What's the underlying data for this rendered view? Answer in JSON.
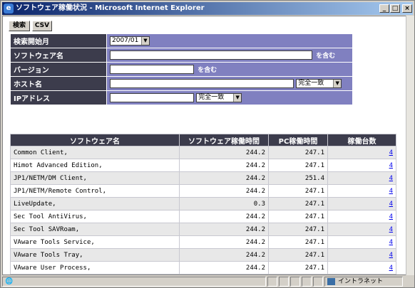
{
  "window": {
    "title": "ソフトウェア稼働状況 - Microsoft Internet Explorer",
    "min": "_",
    "max": "□",
    "close": "×"
  },
  "toolbar": {
    "search_label": "検索",
    "csv_label": "CSV"
  },
  "form": {
    "rows": [
      {
        "label": "検索開始月",
        "value": "2007/01"
      },
      {
        "label": "ソフトウェア名",
        "value": "",
        "suffix": "を含む"
      },
      {
        "label": "バージョン",
        "value": "",
        "suffix": "を含む"
      },
      {
        "label": "ホスト名",
        "value": "",
        "match": "完全一致"
      },
      {
        "label": "IPアドレス",
        "value": "",
        "match": "完全一致"
      }
    ]
  },
  "table": {
    "headers": [
      "ソフトウェア名",
      "ソフトウェア稼働時間",
      "PC稼働時間",
      "稼働台数"
    ],
    "rows": [
      {
        "name": "Common Client,",
        "sw_hours": "244.2",
        "pc_hours": "247.1",
        "count": "4"
      },
      {
        "name": "Himot Advanced Edition,",
        "sw_hours": "244.2",
        "pc_hours": "247.1",
        "count": "4"
      },
      {
        "name": "JP1/NETM/DM Client,",
        "sw_hours": "244.2",
        "pc_hours": "251.4",
        "count": "4"
      },
      {
        "name": "JP1/NETM/Remote Control,",
        "sw_hours": "244.2",
        "pc_hours": "247.1",
        "count": "4"
      },
      {
        "name": "LiveUpdate,",
        "sw_hours": "0.3",
        "pc_hours": "247.1",
        "count": "4"
      },
      {
        "name": "Sec Tool AntiVirus,",
        "sw_hours": "244.2",
        "pc_hours": "247.1",
        "count": "4"
      },
      {
        "name": "Sec Tool SAVRoam,",
        "sw_hours": "244.2",
        "pc_hours": "247.1",
        "count": "4"
      },
      {
        "name": "VAware Tools Service,",
        "sw_hours": "244.2",
        "pc_hours": "247.1",
        "count": "4"
      },
      {
        "name": "VAware Tools Tray,",
        "sw_hours": "244.2",
        "pc_hours": "247.1",
        "count": "4"
      },
      {
        "name": "VAware User Process,",
        "sw_hours": "244.2",
        "pc_hours": "247.1",
        "count": "4"
      }
    ]
  },
  "statusbar": {
    "zone": "イントラネット"
  }
}
